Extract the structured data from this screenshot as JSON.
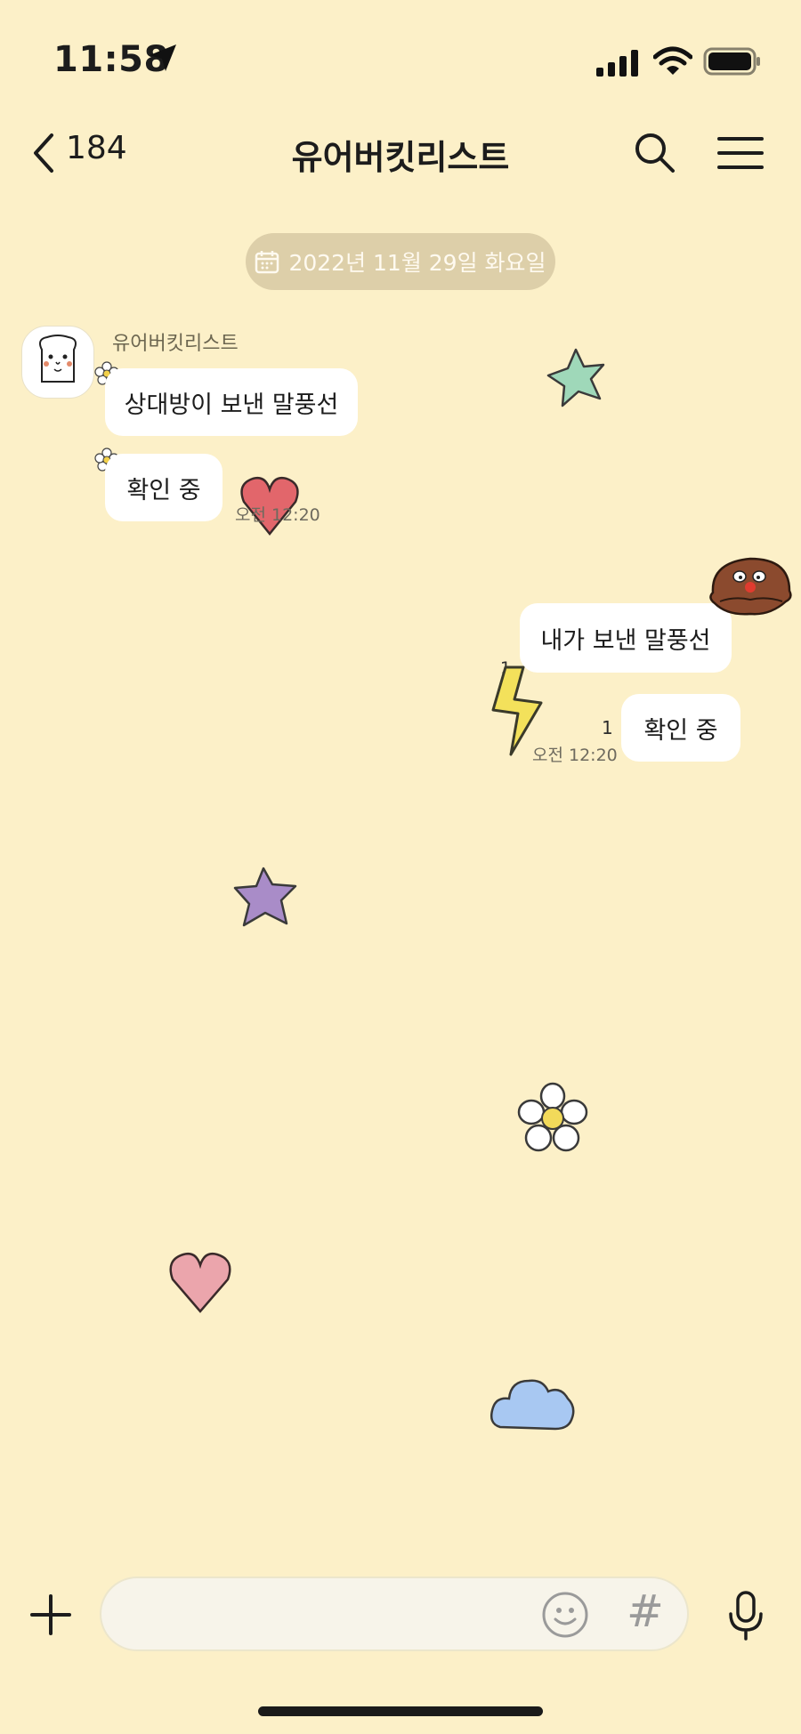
{
  "status_bar": {
    "time": "11:58"
  },
  "header": {
    "back_count": "184",
    "title": "유어버킷리스트"
  },
  "date_separator": {
    "text": "2022년 11월 29일 화요일"
  },
  "messages": {
    "incoming": {
      "sender": "유어버킷리스트",
      "bubbles": [
        "상대방이 보낸 말풍선",
        "확인 중"
      ],
      "time": "오전 12:20"
    },
    "outgoing": {
      "bubbles": [
        "내가 보낸 말풍선",
        "확인 중"
      ],
      "unread_count": "1",
      "stray_count": "1",
      "time": "오전 12:20"
    }
  },
  "input_bar": {
    "value": "",
    "hash_symbol": "#"
  },
  "decorations": [
    "mint-star",
    "red-heart",
    "cookie-character",
    "lightning-bolt",
    "purple-star",
    "daisy-flower",
    "pink-heart",
    "blue-cloud"
  ],
  "colors": {
    "background": "#FCF0C8",
    "bubble": "#FFFFFF",
    "date_pill": "#DDCFA9"
  }
}
